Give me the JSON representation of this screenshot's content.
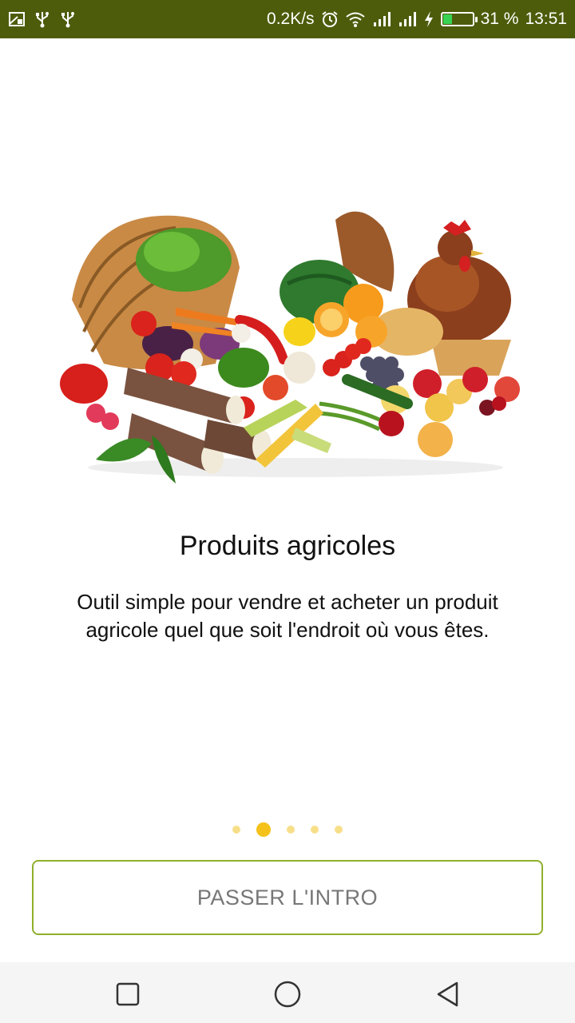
{
  "status_bar": {
    "left_icons": [
      "screenshot-icon",
      "usb-icon",
      "usb-icon"
    ],
    "speed": "0.2K/s",
    "battery_percent_text": "31 %",
    "battery_level": 0.31,
    "time": "13:51"
  },
  "intro": {
    "title": "Produits agricoles",
    "description": "Outil simple pour vendre et acheter un produit agricole quel que soit l'endroit où vous êtes."
  },
  "pager": {
    "count": 5,
    "active_index": 1
  },
  "actions": {
    "skip_label": "PASSER L'INTRO"
  },
  "nav_bar": {
    "buttons": [
      "recent-apps",
      "home",
      "back"
    ]
  }
}
